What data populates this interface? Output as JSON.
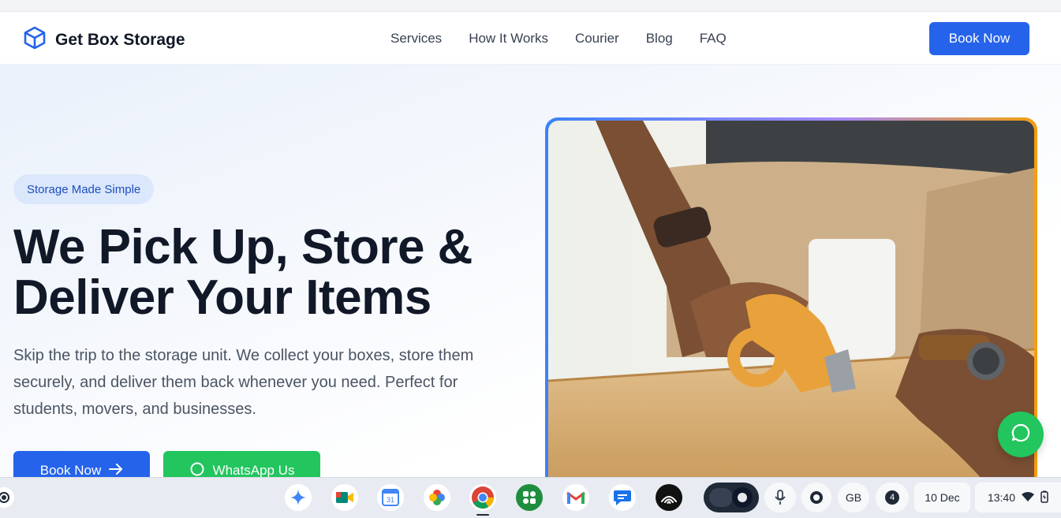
{
  "header": {
    "brand": "Get Box Storage",
    "nav": [
      "Services",
      "How It Works",
      "Courier",
      "Blog",
      "FAQ"
    ],
    "book_button": "Book Now"
  },
  "hero": {
    "pill": "Storage Made Simple",
    "title_line1": "We Pick Up, Store &",
    "title_line2": "Deliver Your Items",
    "subtitle": "Skip the trip to the storage unit. We collect your boxes, store them securely, and deliver them back whenever you need. Perfect for students, movers, and businesses.",
    "cta_primary": "Book Now",
    "cta_secondary": "WhatsApp Us"
  },
  "shelf": {
    "apps": [
      "gemini-icon",
      "meet-icon",
      "calendar-icon",
      "photos-icon",
      "chrome-icon",
      "apps-icon",
      "gmail-icon",
      "messages-icon",
      "audible-icon"
    ],
    "calendar_day": "31",
    "keyboard": "GB",
    "notifications": "4",
    "date": "10 Dec",
    "time": "13:40"
  },
  "colors": {
    "primary": "#2563eb",
    "whatsapp": "#22c55e",
    "text": "#111827"
  }
}
